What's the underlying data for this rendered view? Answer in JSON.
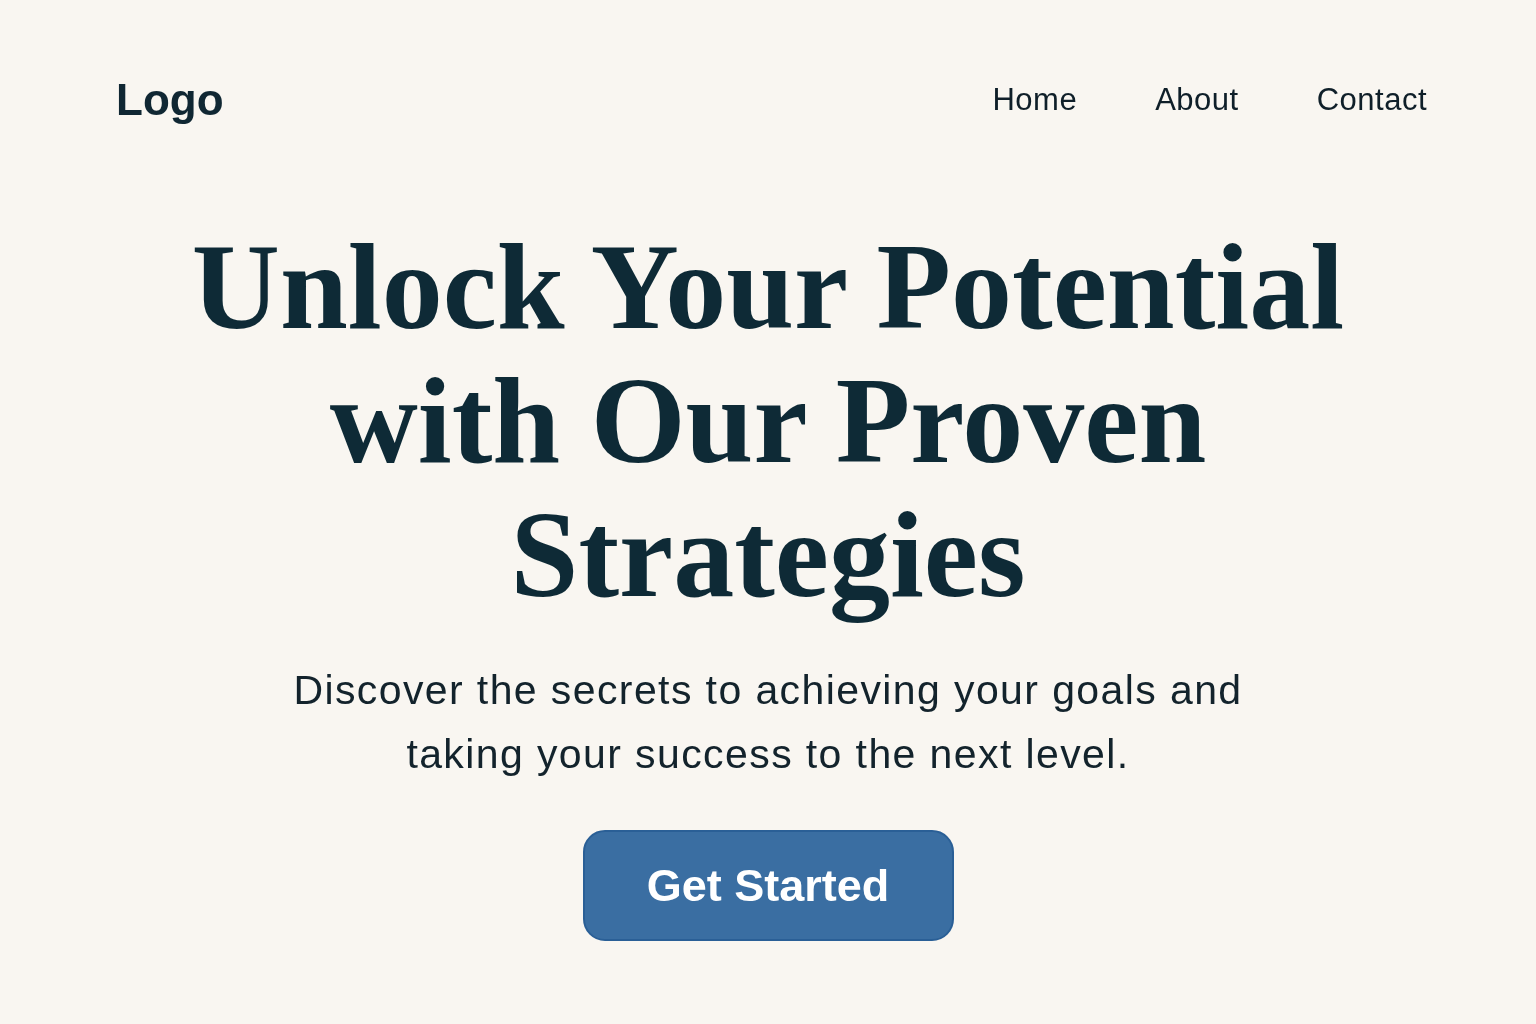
{
  "header": {
    "logo": "Logo",
    "nav": [
      {
        "label": "Home"
      },
      {
        "label": "About"
      },
      {
        "label": "Contact"
      }
    ]
  },
  "hero": {
    "headline_lines": [
      "Unlock Your Potential",
      "with Our Proven",
      "Strategies"
    ],
    "subtitle_lines": [
      "Discover the secrets to achieving your goals and",
      "taking your success to the next level."
    ],
    "button": "Get Started"
  }
}
